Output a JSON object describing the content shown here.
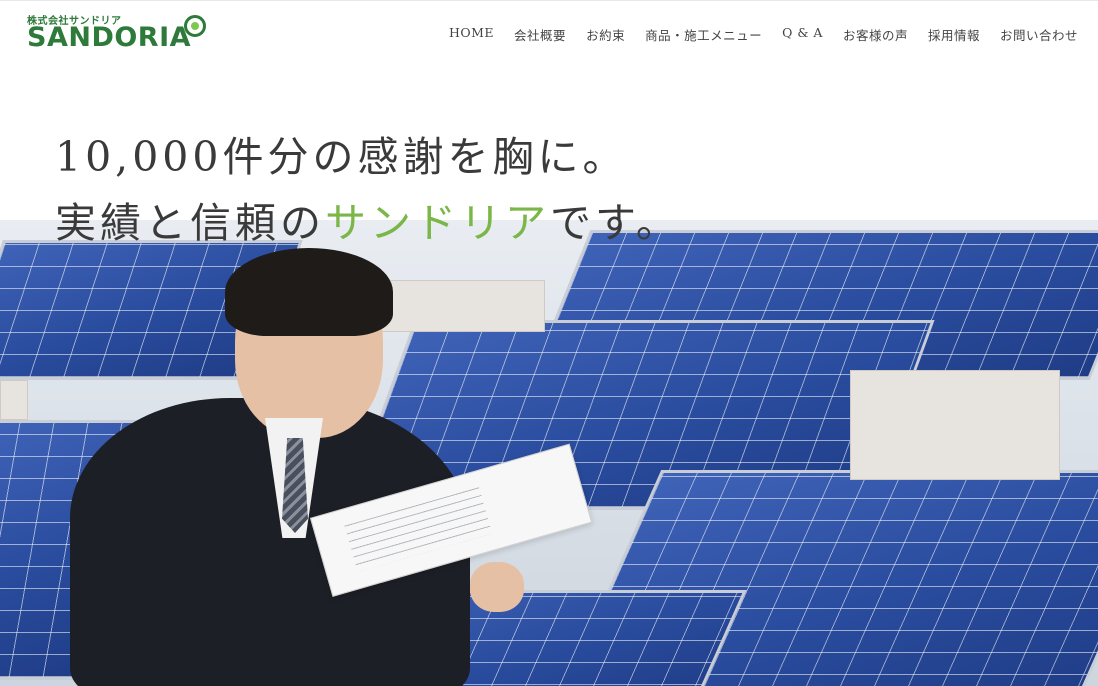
{
  "header": {
    "logo": {
      "small_text": "株式会社サンドリア",
      "main_text": "SANDORIA"
    },
    "nav": [
      {
        "label": "HOME"
      },
      {
        "label": "会社概要"
      },
      {
        "label": "お約束"
      },
      {
        "label": "商品・施工メニュー"
      },
      {
        "label": "Q & A"
      },
      {
        "label": "お客様の声"
      },
      {
        "label": "採用情報"
      },
      {
        "label": "お問い合わせ"
      }
    ]
  },
  "hero": {
    "line1": "10,000件分の感謝を胸に。",
    "line2_before": "実績と信頼の",
    "line2_accent": "サンドリア",
    "line2_after": "です。"
  },
  "colors": {
    "logo_green": "#2d7a3a",
    "accent_green": "#7ab648",
    "text": "#3a3a3a"
  }
}
